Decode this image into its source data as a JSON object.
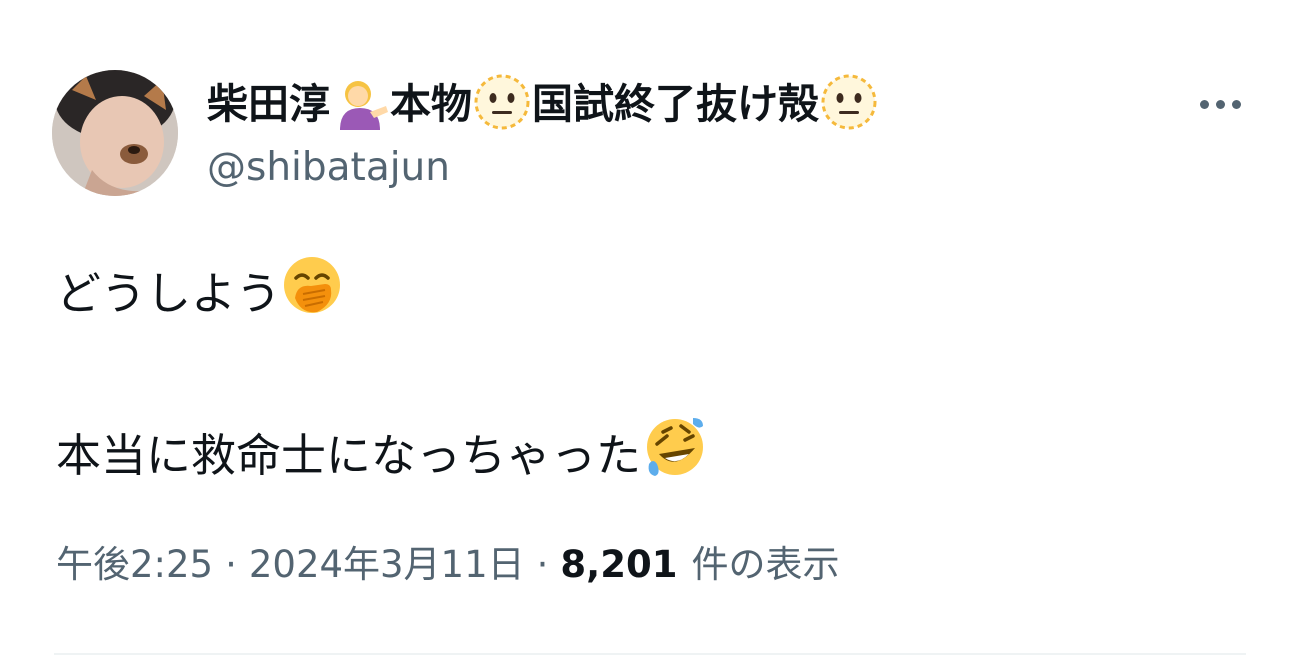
{
  "author": {
    "display_name_parts": [
      "柴田淳",
      "本物",
      "国試終了抜け殻"
    ],
    "handle": "@shibatajun",
    "name_emoji": [
      "person-tipping-hand",
      "dotted-line-face",
      "dotted-line-face"
    ]
  },
  "tweet": {
    "line1": "どうしよう",
    "line1_emoji": "face-with-open-eyes-and-hand-over-mouth",
    "line2": "本当に救命士になっちゃった",
    "line2_emoji": "rolling-on-the-floor-laughing"
  },
  "meta": {
    "time": "午後2:25",
    "sep1": "·",
    "date": "2024年3月11日",
    "sep2": "·",
    "views_count": "8,201",
    "views_label": "件の表示"
  },
  "icons": {
    "more": "more-horizontal-icon"
  },
  "colors": {
    "secondary_text": "#536471",
    "primary_text": "#0f1419",
    "divider": "#eff3f4"
  }
}
